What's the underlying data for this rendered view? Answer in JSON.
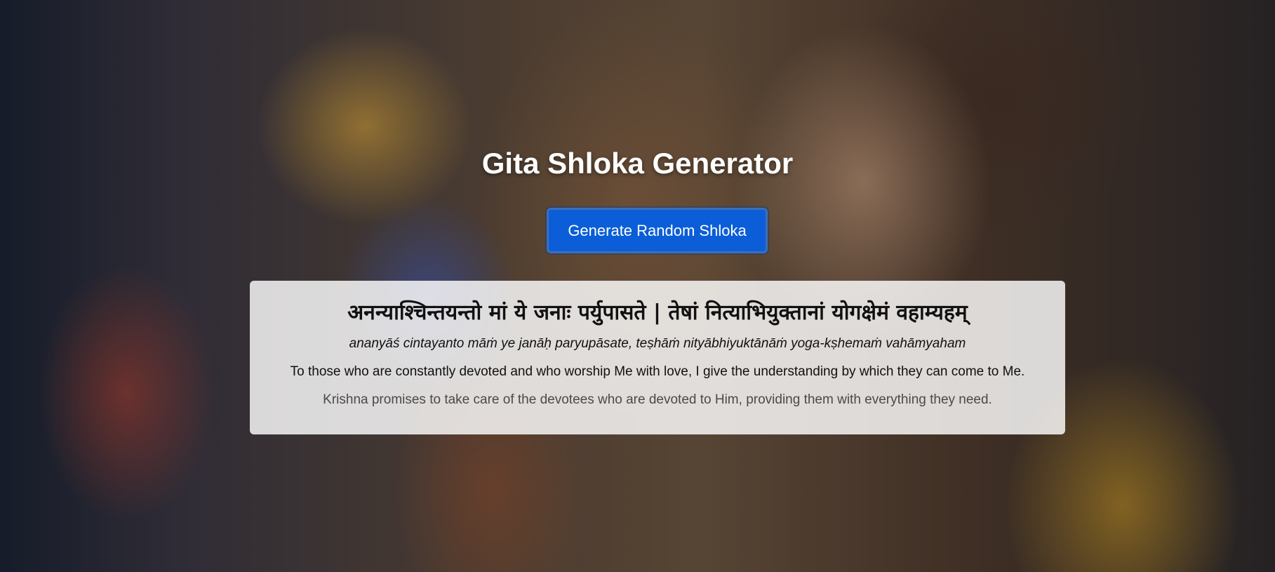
{
  "page": {
    "title": "Gita Shloka Generator"
  },
  "actions": {
    "generate_label": "Generate Random Shloka"
  },
  "shloka": {
    "sanskrit": "अनन्याश्चिन्तयन्तो मां ये जनाः पर्युपासते | तेषां नित्याभियुक्तानां योगक्षेमं वहाम्यहम्",
    "transliteration": "ananyāś cintayanto māṁ ye janāḥ paryupāsate, teṣhāṁ nityābhiyuktānāṁ yoga-kṣhemaṁ vahāmyaham",
    "translation": "To those who are constantly devoted and who worship Me with love, I give the understanding by which they can come to Me.",
    "explanation": "Krishna promises to take care of the devotees who are devoted to Him, providing them with everything they need."
  },
  "colors": {
    "button": "#0b5ed7",
    "title": "#ffffff",
    "card_background": "rgba(255,255,255,0.82)"
  }
}
